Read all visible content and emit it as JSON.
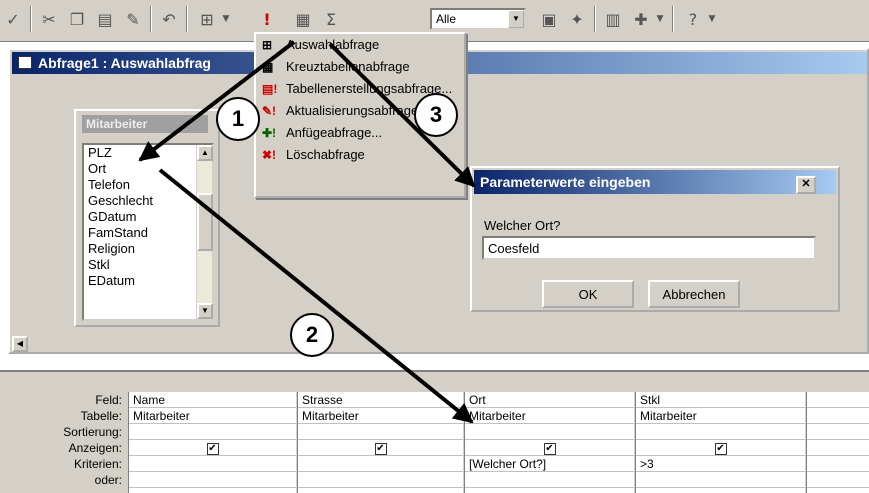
{
  "toolbar": {
    "filter_value": "Alle",
    "icons": [
      "spellcheck-icon",
      "cut-icon",
      "copy-icon",
      "paste-icon",
      "format-painter-icon",
      "undo-icon",
      "query-type-icon",
      "run-icon",
      "show-table-icon",
      "totals-icon",
      "properties-icon",
      "build-icon",
      "database-window-icon",
      "new-object-icon",
      "help-icon"
    ]
  },
  "query_window": {
    "title": "Abfrage1 : Auswahlabfrag"
  },
  "field_list": {
    "title": "Mitarbeiter",
    "items": [
      "PLZ",
      "Ort",
      "Telefon",
      "Geschlecht",
      "GDatum",
      "FamStand",
      "Religion",
      "Stkl",
      "EDatum"
    ]
  },
  "menu": {
    "items": [
      {
        "label": "Auswahlabfrage",
        "icon": "select-query-icon"
      },
      {
        "label": "Kreuztabellenabfrage",
        "icon": "crosstab-query-icon"
      },
      {
        "label": "Tabellenerstellungsabfrage...",
        "icon": "make-table-query-icon"
      },
      {
        "label": "Aktualisierungsabfrage",
        "icon": "update-query-icon"
      },
      {
        "label": "Anfügeabfrage...",
        "icon": "append-query-icon"
      },
      {
        "label": "Löschabfrage",
        "icon": "delete-query-icon"
      }
    ]
  },
  "dialog": {
    "title": "Parameterwerte eingeben",
    "prompt": "Welcher Ort?",
    "value": "Coesfeld",
    "ok_label": "OK",
    "cancel_label": "Abbrechen"
  },
  "grid": {
    "row_labels": [
      "Feld:",
      "Tabelle:",
      "Sortierung:",
      "Anzeigen:",
      "Kriterien:",
      "oder:"
    ],
    "columns": [
      {
        "field": "Name",
        "table": "Mitarbeiter",
        "sort": "",
        "show": true,
        "criteria": ""
      },
      {
        "field": "Strasse",
        "table": "Mitarbeiter",
        "sort": "",
        "show": true,
        "criteria": ""
      },
      {
        "field": "Ort",
        "table": "Mitarbeiter",
        "sort": "",
        "show": true,
        "criteria": "[Welcher Ort?]"
      },
      {
        "field": "Stkl",
        "table": "Mitarbeiter",
        "sort": "",
        "show": true,
        "criteria": ">3"
      }
    ]
  },
  "callouts": [
    "1",
    "2",
    "3"
  ]
}
